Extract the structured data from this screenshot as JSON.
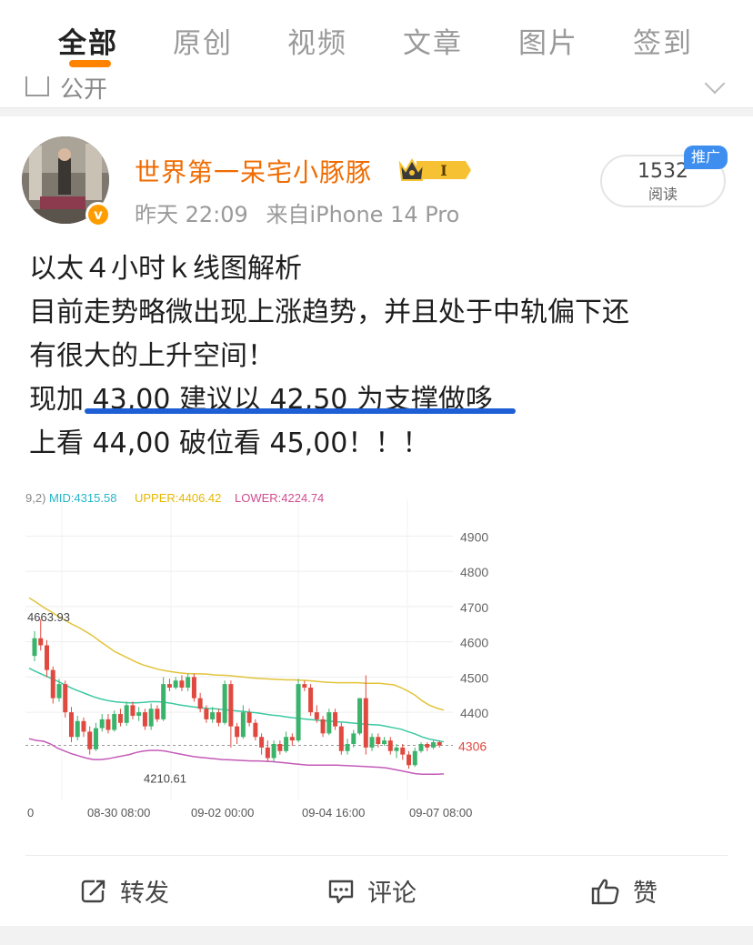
{
  "tabs": [
    "全部",
    "原创",
    "视频",
    "文章",
    "图片",
    "签到"
  ],
  "filter": {
    "label": "公开"
  },
  "post": {
    "username": "世界第一呆宅小豚豚",
    "level_badge": "I",
    "time": "昨天 22:09",
    "source": "来自iPhone 14 Pro",
    "read_count": "1532",
    "read_label": "阅读",
    "promo_badge": "推广",
    "verify_mark": "v",
    "lines": [
      "以太４小时ｋ线图解析",
      "目前走势略微出现上涨趋势，并且处于中轨偏下还",
      "有很大的上升空间！",
      "现加 43,00 建议以 42,50 为支撑做哆",
      "上看 44,00 破位看 45,00！！！"
    ]
  },
  "chart_data": {
    "type": "line",
    "legend": {
      "prefix": "9,2)",
      "mid": "MID:4315.58",
      "upper": "UPPER:4406.42",
      "lower": "LOWER:4224.74"
    },
    "y_ticks": [
      "4900",
      "4800",
      "4700",
      "4600",
      "4500",
      "4400",
      "4306"
    ],
    "y_range": [
      4150,
      4950
    ],
    "x_ticks": [
      "0",
      "08-30 08:00",
      "09-02 00:00",
      "09-04 16:00",
      "09-07 08:00"
    ],
    "high_label": "4663.93",
    "low_label": "4210.61",
    "current_price_label": "4306",
    "colors": {
      "mid": "#3cc9a3",
      "upper": "#e2c43a",
      "lower": "#c45ab8",
      "up": "#3ab36b",
      "down": "#e0493f"
    },
    "upper_band": [
      4725,
      4712,
      4698,
      4686,
      4673,
      4662,
      4650,
      4640,
      4628,
      4615,
      4600,
      4586,
      4572,
      4562,
      4552,
      4542,
      4534,
      4528,
      4522,
      4518,
      4515,
      4512,
      4510,
      4509,
      4509,
      4508,
      4506,
      4505,
      4504,
      4502,
      4500,
      4498,
      4496,
      4495,
      4494,
      4493,
      4492,
      4492,
      4491,
      4490,
      4488,
      4486,
      4485,
      4484,
      4484,
      4484,
      4484,
      4482,
      4482,
      4482,
      4480,
      4478,
      4470,
      4460,
      4448,
      4432,
      4420,
      4412,
      4406
    ],
    "mid_band": [
      4525,
      4515,
      4506,
      4497,
      4488,
      4478,
      4468,
      4460,
      4452,
      4444,
      4438,
      4433,
      4430,
      4428,
      4427,
      4427,
      4428,
      4430,
      4430,
      4428,
      4425,
      4421,
      4418,
      4415,
      4413,
      4411,
      4410,
      4408,
      4406,
      4404,
      4402,
      4400,
      4398,
      4395,
      4392,
      4390,
      4387,
      4384,
      4382,
      4380,
      4378,
      4376,
      4375,
      4373,
      4372,
      4370,
      4368,
      4366,
      4365,
      4364,
      4360,
      4356,
      4352,
      4345,
      4338,
      4330,
      4324,
      4320,
      4316
    ],
    "lower_band": [
      4325,
      4320,
      4318,
      4310,
      4298,
      4290,
      4282,
      4276,
      4270,
      4266,
      4266,
      4268,
      4272,
      4276,
      4280,
      4286,
      4290,
      4292,
      4292,
      4290,
      4286,
      4282,
      4278,
      4274,
      4272,
      4270,
      4268,
      4266,
      4265,
      4264,
      4263,
      4262,
      4262,
      4261,
      4260,
      4258,
      4256,
      4254,
      4252,
      4250,
      4250,
      4250,
      4250,
      4250,
      4249,
      4248,
      4247,
      4246,
      4245,
      4244,
      4242,
      4238,
      4234,
      4230,
      4226,
      4224,
      4224,
      4224,
      4225
    ],
    "candles": [
      [
        4560,
        4610,
        4630,
        4545
      ],
      [
        4610,
        4590,
        4664,
        4575
      ],
      [
        4590,
        4520,
        4605,
        4500
      ],
      [
        4520,
        4440,
        4530,
        4425
      ],
      [
        4440,
        4480,
        4495,
        4430
      ],
      [
        4480,
        4400,
        4490,
        4385
      ],
      [
        4400,
        4330,
        4415,
        4315
      ],
      [
        4330,
        4375,
        4390,
        4320
      ],
      [
        4375,
        4345,
        4385,
        4330
      ],
      [
        4345,
        4295,
        4360,
        4280
      ],
      [
        4295,
        4355,
        4370,
        4290
      ],
      [
        4355,
        4380,
        4395,
        4345
      ],
      [
        4380,
        4350,
        4395,
        4340
      ],
      [
        4350,
        4395,
        4405,
        4345
      ],
      [
        4395,
        4370,
        4410,
        4360
      ],
      [
        4370,
        4420,
        4430,
        4362
      ],
      [
        4420,
        4390,
        4430,
        4380
      ],
      [
        4390,
        4400,
        4415,
        4375
      ],
      [
        4400,
        4360,
        4410,
        4350
      ],
      [
        4360,
        4410,
        4425,
        4350
      ],
      [
        4410,
        4380,
        4420,
        4372
      ],
      [
        4380,
        4480,
        4500,
        4375
      ],
      [
        4480,
        4470,
        4495,
        4460
      ],
      [
        4470,
        4490,
        4500,
        4465
      ],
      [
        4490,
        4470,
        4505,
        4460
      ],
      [
        4470,
        4500,
        4510,
        4460
      ],
      [
        4500,
        4440,
        4510,
        4430
      ],
      [
        4440,
        4410,
        4455,
        4400
      ],
      [
        4410,
        4380,
        4420,
        4370
      ],
      [
        4380,
        4400,
        4415,
        4370
      ],
      [
        4400,
        4370,
        4410,
        4360
      ],
      [
        4370,
        4480,
        4490,
        4365
      ],
      [
        4480,
        4360,
        4490,
        4300
      ],
      [
        4360,
        4330,
        4370,
        4310
      ],
      [
        4330,
        4400,
        4420,
        4325
      ],
      [
        4400,
        4370,
        4410,
        4360
      ],
      [
        4370,
        4330,
        4380,
        4320
      ],
      [
        4330,
        4300,
        4340,
        4280
      ],
      [
        4300,
        4270,
        4320,
        4260
      ],
      [
        4270,
        4310,
        4320,
        4260
      ],
      [
        4310,
        4290,
        4320,
        4280
      ],
      [
        4290,
        4330,
        4345,
        4285
      ],
      [
        4330,
        4320,
        4340,
        4305
      ],
      [
        4320,
        4480,
        4495,
        4315
      ],
      [
        4480,
        4470,
        4490,
        4460
      ],
      [
        4470,
        4400,
        4480,
        4390
      ],
      [
        4400,
        4380,
        4420,
        4370
      ],
      [
        4380,
        4340,
        4390,
        4330
      ],
      [
        4340,
        4400,
        4410,
        4335
      ],
      [
        4400,
        4360,
        4410,
        4350
      ],
      [
        4360,
        4290,
        4370,
        4280
      ],
      [
        4290,
        4310,
        4325,
        4280
      ],
      [
        4310,
        4340,
        4350,
        4300
      ],
      [
        4340,
        4440,
        4440,
        4335
      ],
      [
        4440,
        4300,
        4505,
        4280
      ],
      [
        4300,
        4330,
        4340,
        4290
      ],
      [
        4330,
        4310,
        4340,
        4300
      ],
      [
        4310,
        4320,
        4330,
        4305
      ],
      [
        4320,
        4290,
        4330,
        4280
      ],
      [
        4290,
        4300,
        4310,
        4270
      ],
      [
        4300,
        4280,
        4310,
        4265
      ],
      [
        4280,
        4250,
        4290,
        4240
      ],
      [
        4250,
        4290,
        4300,
        4245
      ],
      [
        4290,
        4310,
        4315,
        4285
      ],
      [
        4310,
        4300,
        4315,
        4290
      ],
      [
        4300,
        4315,
        4320,
        4295
      ],
      [
        4315,
        4306,
        4320,
        4300
      ]
    ]
  },
  "actions": {
    "repost": "转发",
    "comment": "评论",
    "like": "赞"
  }
}
